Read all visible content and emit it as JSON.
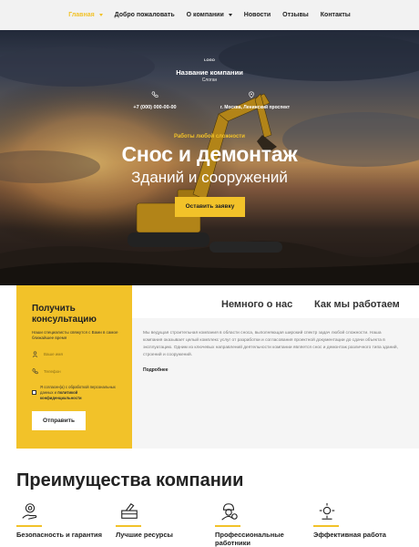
{
  "nav": {
    "items": [
      {
        "label": "Главная",
        "dropdown": true,
        "active": true
      },
      {
        "label": "Добро пожаловать",
        "dropdown": false,
        "active": false
      },
      {
        "label": "О компании",
        "dropdown": true,
        "active": false
      },
      {
        "label": "Новости",
        "dropdown": false,
        "active": false
      },
      {
        "label": "Отзывы",
        "dropdown": false,
        "active": false
      },
      {
        "label": "Контакты",
        "dropdown": false,
        "active": false
      }
    ]
  },
  "hero": {
    "logo": "LOGO",
    "company_name": "Название компании",
    "company_sub": "Слоган",
    "phone": "+7 (000) 000-00-00",
    "address": "г. Москва, Ленинский проспект",
    "kicker": "Работы любой сложности",
    "title": "Снос и демонтаж",
    "subtitle": "Зданий и сооружений",
    "cta": "Оставить заявку"
  },
  "consult": {
    "title": "Получить консультацию",
    "desc": "Наши специалисты свяжутся с Вами в самое ближайшее время",
    "name_placeholder": "Ваше имя",
    "phone_placeholder": "Телефон",
    "agree_text": "Я согласен(а) с обработкой персональных данных и",
    "agree_link": "политикой конфиденциальности",
    "submit": "Отправить"
  },
  "about": {
    "tabs": [
      "Немного о нас",
      "Как мы работаем"
    ],
    "text": "Мы ведущая строительная компания в области сноса, выполняющая широкий спектр задач любой сложности. Наша компания оказывает целый комплекс услуг от разработки и согласования проектной документации до сдачи объекта в эксплуатацию. Одним из ключевых направлений деятельности компании является снос и демонтаж различного типа зданий, строений и сооружений.",
    "more": "Подробнее"
  },
  "advantages": {
    "title": "Преимущества компании",
    "items": [
      {
        "icon": "gear-hand-icon",
        "label": "Безопасность и гарантия"
      },
      {
        "icon": "toolbox-icon",
        "label": "Лучшие ресурсы"
      },
      {
        "icon": "worker-icon",
        "label": "Профессиональные работники"
      },
      {
        "icon": "efficiency-icon",
        "label": "Эффективная работа"
      }
    ]
  },
  "colors": {
    "accent": "#f2c229",
    "nav_bg": "#f2f2f2"
  }
}
